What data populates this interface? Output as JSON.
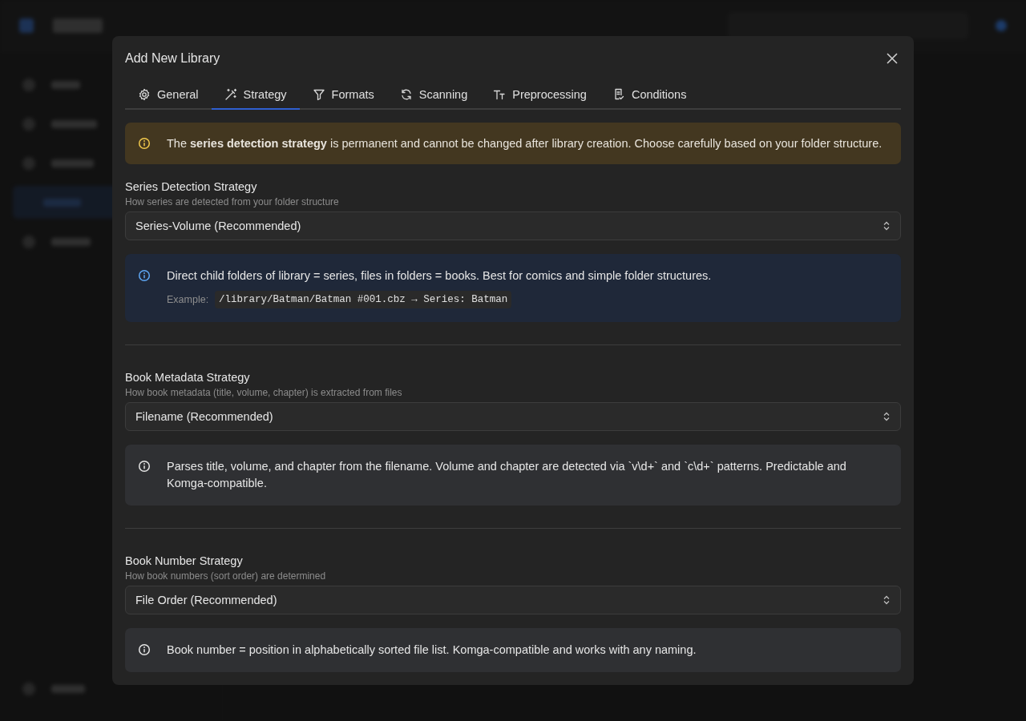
{
  "dialog": {
    "title": "Add New Library",
    "tabs": [
      {
        "label": "General",
        "selected": false
      },
      {
        "label": "Strategy",
        "selected": true
      },
      {
        "label": "Formats",
        "selected": false
      },
      {
        "label": "Scanning",
        "selected": false
      },
      {
        "label": "Preprocessing",
        "selected": false
      },
      {
        "label": "Conditions",
        "selected": false
      }
    ],
    "warning": "The **series detection strategy** is permanent and cannot be changed after library creation. Choose carefully based on your folder structure.",
    "sections": [
      {
        "label": "Series Detection Strategy",
        "hint": "How series are detected from your folder structure",
        "value": "Series-Volume (Recommended)",
        "note": {
          "kind": "info",
          "text": "Direct child folders of library = series, files in folders = books. Best for comics and simple folder structures.",
          "example_label": "Example:",
          "example_code": "/library/Batman/Batman #001.cbz → Series: Batman"
        }
      },
      {
        "label": "Book Metadata Strategy",
        "hint": "How book metadata (title, volume, chapter) is extracted from files",
        "value": "Filename (Recommended)",
        "note": {
          "kind": "neutral",
          "text": "Parses title, volume, and chapter from the filename. Volume and chapter are detected via `v\\d+` and `c\\d+` patterns. Predictable and Komga-compatible."
        }
      },
      {
        "label": "Book Number Strategy",
        "hint": "How book numbers (sort order) are determined",
        "value": "File Order (Recommended)",
        "note": {
          "kind": "neutral",
          "text": "Book number = position in alphabetically sorted file list. Komga-compatible and works with any naming."
        }
      }
    ]
  }
}
